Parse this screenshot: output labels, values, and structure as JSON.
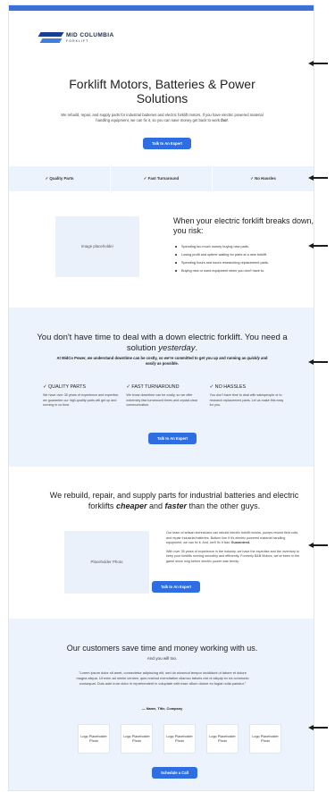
{
  "brand": {
    "name": "MID COLUMBIA",
    "sub": "FORKLIFT"
  },
  "hero": {
    "title": "Forklift Motors, Batteries & Power Solutions",
    "lead": "We rebuild, repair, and supply parts for industrial batteries and electric forklift motors. If you have electric powered material handling equipment, we can fix it, so you can save money get back to work fast.",
    "cta": "Talk to An Expert"
  },
  "features": [
    "✓ Quality Parts",
    "✓ Fast Turnaround",
    "✓ No Hassles"
  ],
  "risk": {
    "image": "Image placeholder",
    "title": "When your electric forklift breaks down, you risk:",
    "items": [
      "Spending too much money buying new parts.",
      "Losing profit and uptime waiting for parts at a new forklift.",
      "Spending hours and hours researching replacement parts.",
      "Buying new or used equipment when you don't have to."
    ]
  },
  "downtime": {
    "title": "You don't have time to deal with a down electric forklift. You need a solution yesterday.",
    "lead": "At MidCo Power, we understand downtime can be costly, so we're committed to get you up and running as quickly and easily as possible.",
    "columns": [
      {
        "title": "✓ QUALITY PARTS",
        "text": "We have over 35 years of experience and expertise, we guarantee our high-quality parts will get up and running in no time."
      },
      {
        "title": "✓ FAST TURNAROUND",
        "text": "We know downtime can be costly, so we offer extremely fast turnaround times and crystal-clear communication."
      },
      {
        "title": "✓ NO HASSLES",
        "text": "You don't have time to deal with salespeople or to research replacement parts. Let us make this easy for you."
      }
    ],
    "cta": "Talk to An Expert"
  },
  "rebuild": {
    "title": "We rebuild, repair, and supply parts for industrial batteries and electric forklifts cheaper and faster than the other guys.",
    "image": "Placeholder Photo",
    "p1": "Our team of artisan technicians can rebuild electric forklift motors, pumps rewind field coils, and repair industrial batteries. Bottom line if it's electric powered material handling equipment, we can fix it. And, we'll fix it fast. Guaranteed.",
    "p2": "With over 35 years of experience in the industry, we have the expertise and the inventory to keep your forklifts running smoothly and efficiently. Formerly B&B Motors, we've been in the game since long before electric power was trendy.",
    "cta": "Talk to An Expert"
  },
  "customers": {
    "title": "Our customers save time and money working with us.",
    "subtitle": "And you will too.",
    "quote": "\"Lorem ipsum dolor sit amet, consectetur adipiscing elit, sed do eiusmod tempor incididunt ut labore et dolore magna aliqua. Ut enim ad minim veniam, quis nostrud exercitation ullamco laboris nisi ut aliquip ex ea commodo consequat. Duis aute irure dolor in reprehenderit in voluptate velit esse cillum dolore eu fugiat nulla pariatur.\"",
    "attribution": "— Name, Title, Company",
    "logos": [
      "Logo Placeholder Photo",
      "Logo Placeholder Photo",
      "Logo Placeholder Photo",
      "Logo Placeholder Photo",
      "Logo Placeholder Photo"
    ],
    "cta": "Schedule a Call"
  },
  "colors": {
    "accent": "#2e6ee0",
    "band": "#edf3fc",
    "topbar": "#3a71d8"
  },
  "annotations": [
    "arrow-icon",
    "arrow-icon",
    "arrow-icon",
    "arrow-icon",
    "arrow-icon",
    "arrow-icon"
  ]
}
